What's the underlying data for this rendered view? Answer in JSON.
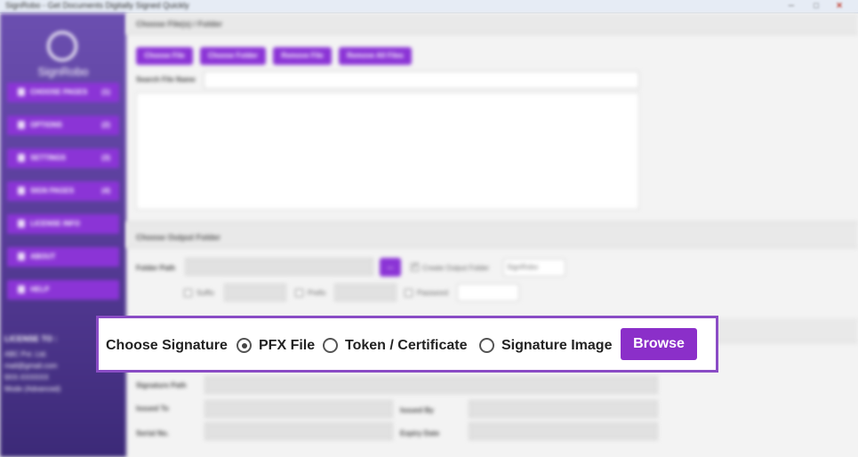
{
  "window": {
    "title": "SignRobo - Get Documents Digitally Signed Quickly",
    "controls": {
      "minimize": "─",
      "maximize": "□",
      "close": "✕"
    }
  },
  "sidebar": {
    "logo_text": "SignRobo",
    "items": [
      {
        "label": "CHOOSE PAGES",
        "count": "(1)",
        "icon": "file-icon"
      },
      {
        "label": "OPTIONS",
        "count": "(2)",
        "icon": "options-icon"
      },
      {
        "label": "SETTINGS",
        "count": "(3)",
        "icon": "gear-icon"
      },
      {
        "label": "SIGN PAGES",
        "count": "(4)",
        "icon": "sign-icon"
      },
      {
        "label": "LICENSE INFO",
        "count": "",
        "icon": "license-icon"
      },
      {
        "label": "ABOUT",
        "count": "",
        "icon": "info-icon"
      },
      {
        "label": "HELP",
        "count": "",
        "icon": "help-icon"
      }
    ],
    "license": {
      "heading": "LICENSE TO :",
      "lines": [
        "ABC Pvt. Ltd.",
        "mail@gmail.com",
        "9XX-XXXXXX",
        "Mode (Advanced)"
      ]
    }
  },
  "files_section": {
    "heading": "Choose File(s) / Folder",
    "buttons": [
      "Choose File",
      "Choose Folder",
      "Remove File",
      "Remove All Files"
    ],
    "search_label": "Search File Name"
  },
  "output_section": {
    "heading": "Choose Output Folder",
    "folder_label": "Folder Path",
    "browse_small": "...",
    "create_output_folder_label": "Create Output Folder",
    "output_folder_value": "SignRobo",
    "suffix_label": "Suffix",
    "prefix_label": "Prefix",
    "password_label": "Password"
  },
  "signature": {
    "title": "Choose Signature",
    "options": [
      "PFX File",
      "Token / Certificate",
      "Signature Image"
    ],
    "selected": "PFX File",
    "browse_label": "Browse",
    "path_label": "Signature Path",
    "issued_to_label": "Issued To",
    "issued_by_label": "Issued By",
    "serial_label": "Serial No.",
    "expiry_label": "Expiry Date"
  },
  "colors": {
    "accent": "#8b2fc9",
    "sidebar": "#5a3e9b",
    "highlight_border": "#8a4cc5"
  }
}
